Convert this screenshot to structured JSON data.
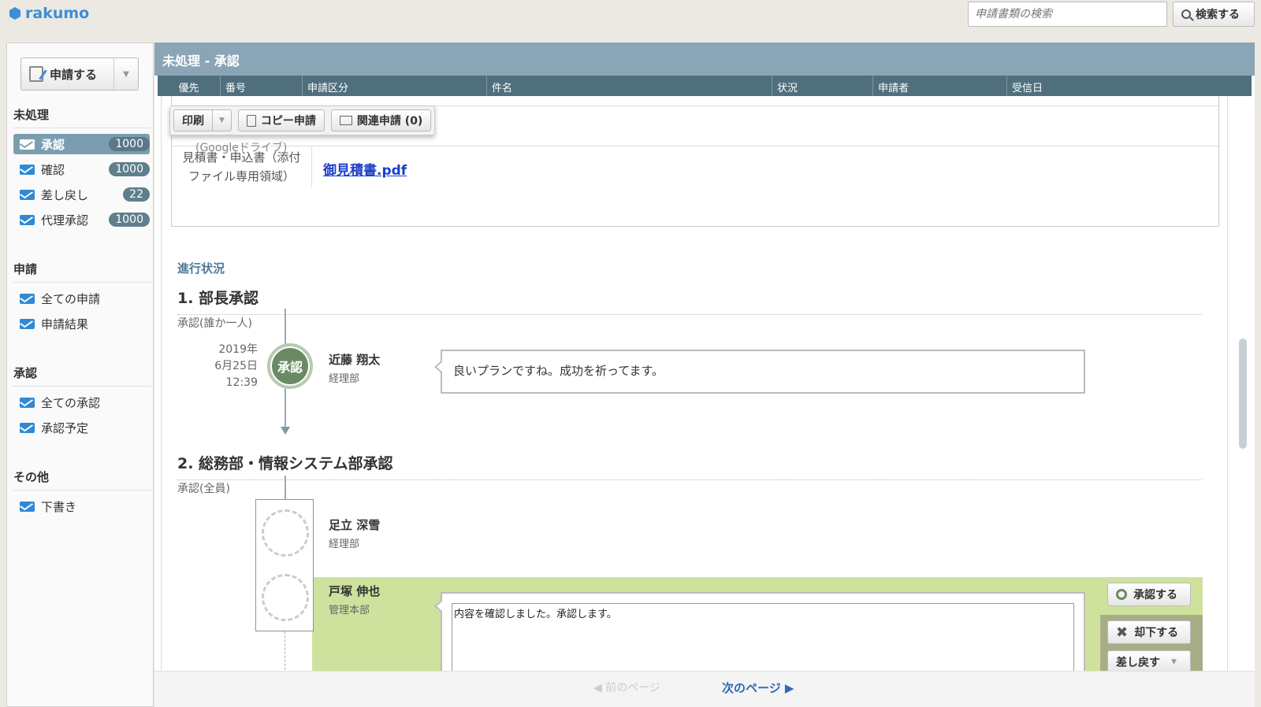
{
  "app": {
    "logo_text": "rakumo"
  },
  "search": {
    "placeholder": "申請書類の検索",
    "button_label": "検索する"
  },
  "sidebar": {
    "apply_button": "申請する",
    "sections": [
      {
        "title": "未処理",
        "items": [
          {
            "label": "承認",
            "count": "1000",
            "active": true
          },
          {
            "label": "確認",
            "count": "1000"
          },
          {
            "label": "差し戻し",
            "count": "22"
          },
          {
            "label": "代理承認",
            "count": "1000"
          }
        ]
      },
      {
        "title": "申請",
        "items": [
          {
            "label": "全ての申請"
          },
          {
            "label": "申請結果"
          }
        ]
      },
      {
        "title": "承認",
        "items": [
          {
            "label": "全ての承認"
          },
          {
            "label": "承認予定"
          }
        ]
      },
      {
        "title": "その他",
        "items": [
          {
            "label": "下書き"
          }
        ]
      }
    ]
  },
  "main": {
    "title": "未処理 - 承認",
    "columns": [
      "優先",
      "番号",
      "申請区分",
      "件名",
      "状況",
      "申請者",
      "受信日"
    ]
  },
  "toolbar": {
    "print": "印刷",
    "copy": "コピー申請",
    "related": "関連申請 (0)"
  },
  "attachment": {
    "partial_text": "(Googleドライブ)",
    "label_line1": "見積書・申込書（添付",
    "label_line2": "ファイル専用領域）",
    "file_link": "御見積書.pdf"
  },
  "progress": {
    "section_label": "進行状況",
    "step1": {
      "title": "1. 部長承認",
      "sub": "承認(誰か一人)",
      "date_year": "2019年",
      "date_day": "6月25日",
      "date_time": "12:39",
      "stamp": "承認",
      "approver_name": "近藤 翔太",
      "approver_dept": "経理部",
      "comment": "良いプランですね。成功を祈ってます。"
    },
    "step2": {
      "title": "2. 総務部・情報システム部承認",
      "sub": "承認(全員)",
      "approver1_name": "足立 深雪",
      "approver1_dept": "経理部",
      "approver2_name": "戸塚 伸也",
      "approver2_dept": "管理本部",
      "comment_value": "内容を確認しました。承認します。"
    }
  },
  "actions": {
    "approve": "承認する",
    "reject": "却下する",
    "send_back": "差し戻す"
  },
  "pager": {
    "prev": "◀ 前のページ",
    "next": "次のページ ▶"
  }
}
